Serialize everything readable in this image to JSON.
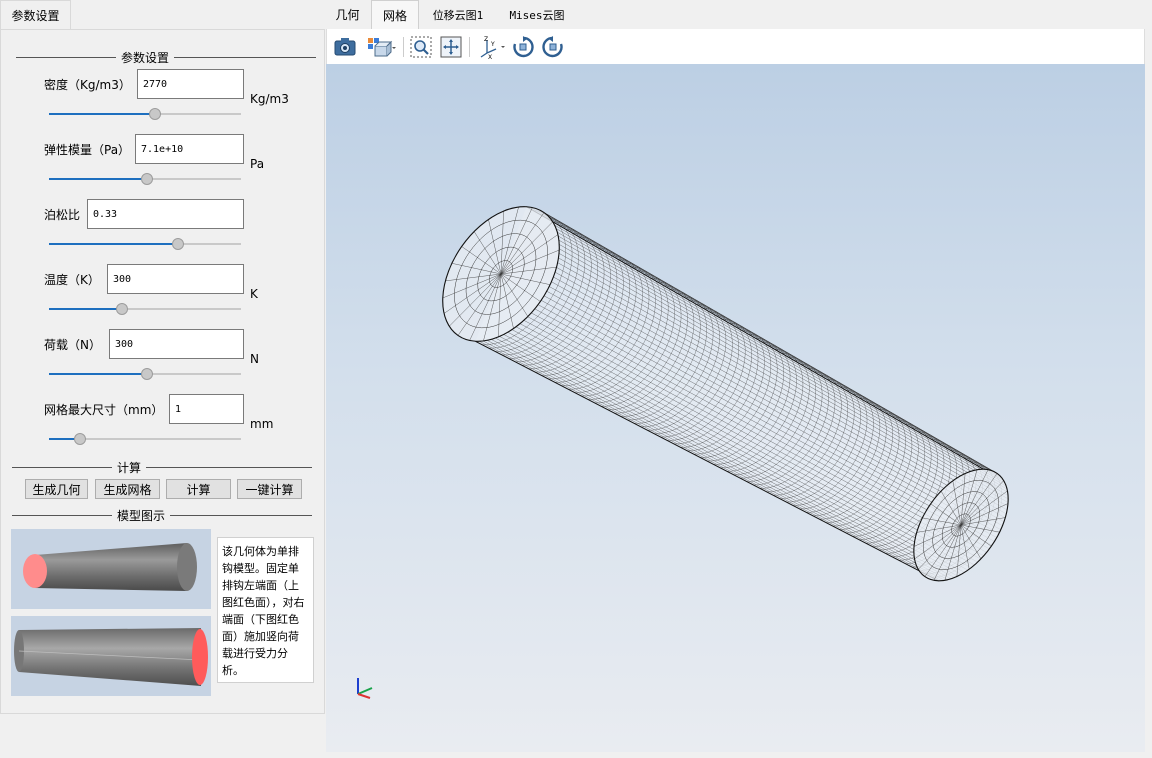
{
  "left_tab": "参数设置",
  "params_group_title": "参数设置",
  "params": [
    {
      "label": "密度（Kg/m3）",
      "value": "2770",
      "unit": "Kg/m3",
      "slider": 0.55
    },
    {
      "label": "弹性模量（Pa）",
      "value": "7.1e+10",
      "unit": "Pa",
      "slider": 0.51
    },
    {
      "label": "泊松比",
      "value": "0.33",
      "unit": "",
      "slider": 0.67
    },
    {
      "label": "温度（K）",
      "value": "300",
      "unit": "K",
      "slider": 0.38
    },
    {
      "label": "荷载（N）",
      "value": "300",
      "unit": "N",
      "slider": 0.51
    },
    {
      "label": "网格最大尺寸（mm）",
      "value": "1",
      "unit": "mm",
      "slider": 0.16
    }
  ],
  "compute_group_title": "计算",
  "buttons": {
    "gen_geometry": "生成几何",
    "gen_mesh": "生成网格",
    "compute": "计算",
    "one_click": "一键计算"
  },
  "model_group_title": "模型图示",
  "model_description": "该几何体为单排钩模型。固定单排钩左端面（上图红色面），对右端面（下图红色面）施加竖向荷载进行受力分析。",
  "tabs": [
    {
      "label": "几何",
      "active": false
    },
    {
      "label": "网格",
      "active": true
    },
    {
      "label": "位移云图1",
      "active": false
    },
    {
      "label": "Mises云图",
      "active": false
    }
  ],
  "toolbar_icons": [
    "camera-icon",
    "view-cube-icon",
    "zoom-box-icon",
    "fit-all-icon",
    "axes-icon",
    "rotate-cw-icon",
    "rotate-ccw-icon"
  ],
  "colors": {
    "fixed_face": "#ff8c8c",
    "load_face": "#ff5b5b",
    "slider_fill": "#1e6fbf"
  }
}
